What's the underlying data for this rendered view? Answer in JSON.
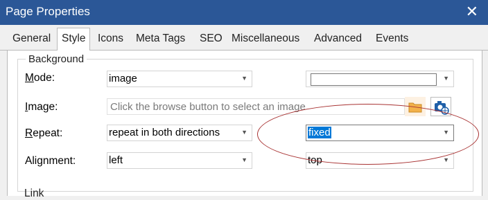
{
  "window": {
    "title": "Page Properties",
    "close_glyph": "✕"
  },
  "tabs": [
    {
      "label": "General"
    },
    {
      "label": "Style"
    },
    {
      "label": "Icons"
    },
    {
      "label": "Meta Tags"
    },
    {
      "label": "SEO"
    },
    {
      "label": "Miscellaneous"
    },
    {
      "label": "Advanced"
    },
    {
      "label": "Events"
    }
  ],
  "active_tab": "Style",
  "background": {
    "legend": "Background",
    "mode": {
      "label_first": "M",
      "label_rest": "ode:",
      "value": "image"
    },
    "color": {
      "value": ""
    },
    "image": {
      "label_first": "I",
      "label_rest": "mage:",
      "placeholder": "Click the browse button to select an image"
    },
    "repeat": {
      "label_first": "R",
      "label_rest": "epeat:",
      "value": "repeat in both directions",
      "attachment_value": "fixed"
    },
    "alignment": {
      "label": "Alignment:",
      "horizontal": "left",
      "vertical": "top"
    }
  },
  "next_group_label": "Link",
  "icons": {
    "browse": "folder-icon",
    "web_image": "camera-globe-icon",
    "dropdown": "chevron-down-icon"
  },
  "colors": {
    "titlebar": "#2b5797",
    "highlight": "#0078d7",
    "annotation": "#a83232"
  }
}
